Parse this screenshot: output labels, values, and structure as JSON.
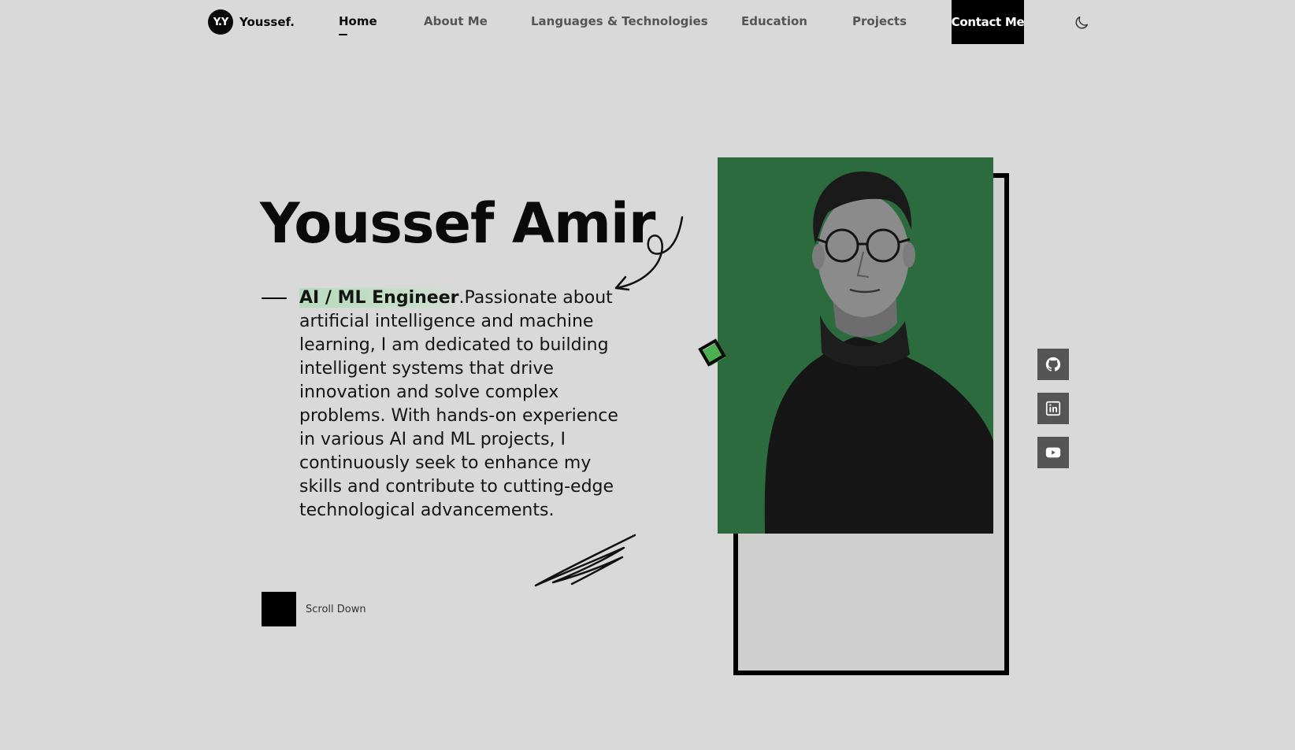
{
  "header": {
    "logo_mark": "Y.Y",
    "logo_text": "Youssef.",
    "nav": [
      {
        "label": "Home"
      },
      {
        "label": "About Me"
      },
      {
        "label": "Languages & Technologies"
      },
      {
        "label": "Education"
      },
      {
        "label": "Projects"
      }
    ],
    "active_nav": "Home",
    "contact_label": "Contact Me",
    "theme_icon": "moon-icon"
  },
  "hero": {
    "name": "Youssef Amir",
    "role": "AI / ML Engineer",
    "description": ".Passionate about artificial intelligence and machine learning, I am dedicated to building intelligent systems that drive innovation and solve complex problems. With hands-on experience in various AI and ML projects, I continuously seek to enhance my skills and contribute to cutting-edge technological advancements.",
    "scroll_label": "Scroll Down"
  },
  "social": [
    {
      "icon": "github-icon"
    },
    {
      "icon": "linkedin-icon"
    },
    {
      "icon": "youtube-icon"
    }
  ],
  "colors": {
    "background": "#d9d9d9",
    "photo_bg": "#2c6b3e",
    "role_highlight": "#b7dbbd",
    "diamond_green": "#4caf50",
    "social_bg": "#555555"
  }
}
